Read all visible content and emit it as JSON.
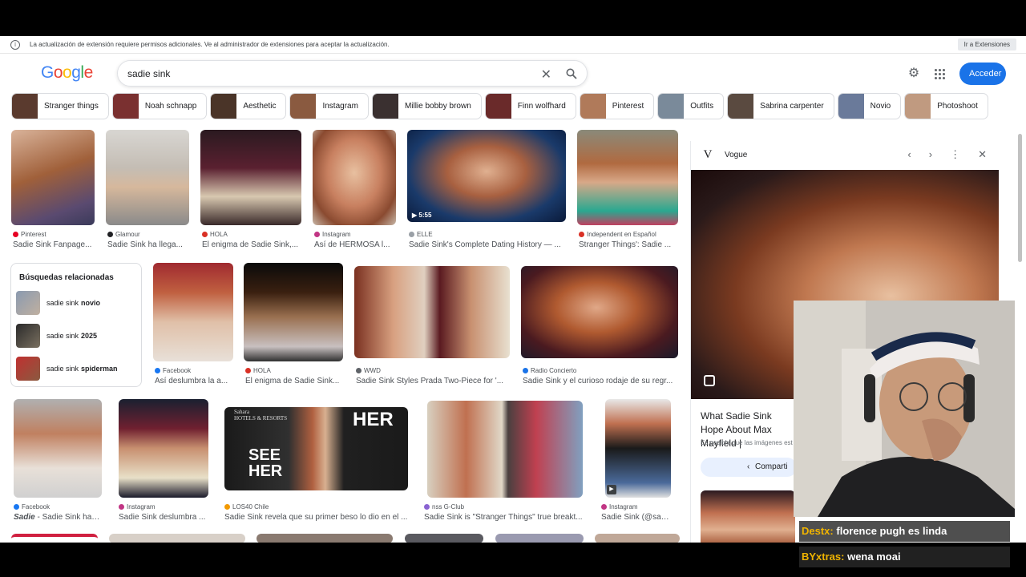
{
  "infobar": {
    "message": "La actualización de extensión requiere permisos adicionales. Ve al administrador de extensiones para aceptar la actualización.",
    "button": "Ir a Extensiones"
  },
  "logo": {
    "letters": [
      "G",
      "o",
      "o",
      "g",
      "l",
      "e"
    ],
    "colors": [
      "#4285f4",
      "#ea4335",
      "#fbbc05",
      "#4285f4",
      "#34a853",
      "#ea4335"
    ]
  },
  "search": {
    "query": "sadie sink"
  },
  "header": {
    "signin": "Acceder"
  },
  "chips": [
    {
      "label": "Stranger things",
      "color": "#5a3a2e"
    },
    {
      "label": "Noah schnapp",
      "color": "#7a3030"
    },
    {
      "label": "Aesthetic",
      "color": "#4a3428"
    },
    {
      "label": "Instagram",
      "color": "#8a5a40"
    },
    {
      "label": "Millie bobby brown",
      "color": "#3a3030"
    },
    {
      "label": "Finn wolfhard",
      "color": "#6a2a2a"
    },
    {
      "label": "Pinterest",
      "color": "#b07a5a"
    },
    {
      "label": "Outfits",
      "color": "#7a8a9a"
    },
    {
      "label": "Sabrina carpenter",
      "color": "#5a4a40"
    },
    {
      "label": "Novio",
      "color": "#6a7a9a"
    },
    {
      "label": "Photoshoot",
      "color": "#c09a80"
    }
  ],
  "row1": [
    {
      "source": "Pinterest",
      "caption": "Sadie Sink Fanpage...",
      "dot": "#e60023"
    },
    {
      "source": "Glamour",
      "caption": "Sadie Sink ha llega...",
      "dot": "#202124"
    },
    {
      "source": "HOLA",
      "caption": "El enigma de Sadie Sink,...",
      "dot": "#d93025"
    },
    {
      "source": "Instagram",
      "caption": "Así de HERMOSA l...",
      "dot": "#c13584"
    },
    {
      "source": "ELLE",
      "caption": "Sadie Sink's Complete Dating History — ...",
      "dot": "#9aa0a6",
      "duration": "5:55"
    },
    {
      "source": "Independent en Español",
      "caption": "Stranger Things': Sadie ...",
      "dot": "#d93025"
    }
  ],
  "related": {
    "title": "Búsquedas relacionadas",
    "items": [
      {
        "prefix": "sadie sink",
        "bold": "novio"
      },
      {
        "prefix": "sadie sink",
        "bold": "2025"
      },
      {
        "prefix": "sadie sink",
        "bold": "spiderman"
      }
    ]
  },
  "row2": [
    {
      "source": "Facebook",
      "caption": "Así deslumbra la a...",
      "dot": "#1877f2"
    },
    {
      "source": "HOLA",
      "caption": "El enigma de Sadie Sink...",
      "dot": "#d93025"
    },
    {
      "source": "WWD",
      "caption": "Sadie Sink Styles Prada Two-Piece for '...",
      "dot": "#5f6368"
    },
    {
      "source": "Radio Concierto",
      "caption": "Sadie Sink y el curioso rodaje de su regr...",
      "dot": "#1a73e8"
    }
  ],
  "row3": [
    {
      "source": "Facebook",
      "caption_bold": "Sadie",
      "caption": " - Sadie Sink hac...",
      "dot": "#1877f2"
    },
    {
      "source": "Instagram",
      "caption": "Sadie Sink deslumbra ...",
      "dot": "#c13584"
    },
    {
      "source": "LOS40 Chile",
      "caption": "Sadie Sink revela que su primer beso lo dio en el ...",
      "dot": "#f29900"
    },
    {
      "source": "nss G-Club",
      "caption": "Sadie Sink is \"Stranger Things\" true breakt...",
      "dot": "#8a63d2"
    },
    {
      "source": "Instagram",
      "caption": "Sadie Sink (@sadi...",
      "dot": "#c13584"
    }
  ],
  "image_text": {
    "see_her": "SEE\nHER",
    "her": "HER",
    "hotels": "Sahara\nHOTELS & RESORTS"
  },
  "panel": {
    "source": "Vogue",
    "logo": "V",
    "title": "What Sadie Sink Hope About Max Mayfield |",
    "note": "Es posible que las imágenes est",
    "share": "Comparti"
  },
  "chat": [
    {
      "user": "Destx:",
      "message": "florence pugh es linda"
    },
    {
      "user": "BYxtras:",
      "message": "wena moai"
    }
  ]
}
